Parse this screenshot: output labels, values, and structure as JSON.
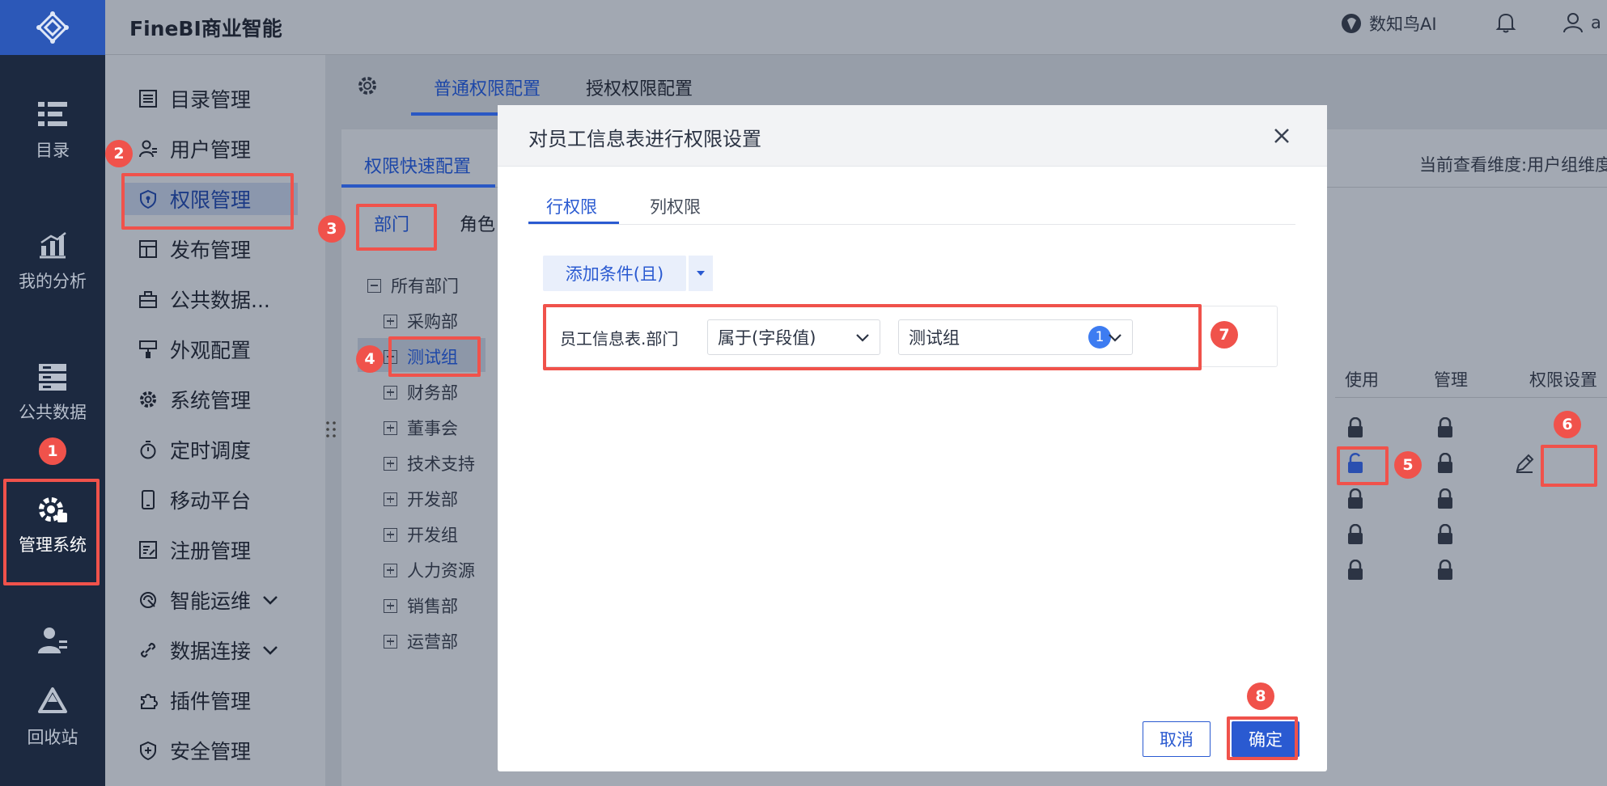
{
  "topbar": {
    "brand": "FineBI商业智能",
    "ai_label": "数知鸟AI",
    "user_initial": "a"
  },
  "leftnav": {
    "items": [
      {
        "label": "目录",
        "icon": "catalog-icon"
      },
      {
        "label": "我的分析",
        "icon": "analysis-icon"
      },
      {
        "label": "公共数据",
        "icon": "public-data-icon"
      },
      {
        "label": "管理系统",
        "icon": "admin-system-icon"
      },
      {
        "label": "",
        "icon": "user-admin-icon"
      },
      {
        "label": "回收站",
        "icon": "recycle-bin-icon"
      }
    ]
  },
  "subnav": {
    "items": [
      {
        "label": "目录管理",
        "icon": "list-icon"
      },
      {
        "label": "用户管理",
        "icon": "user-icon"
      },
      {
        "label": "权限管理",
        "icon": "shield-icon"
      },
      {
        "label": "发布管理",
        "icon": "publish-icon"
      },
      {
        "label": "公共数据...",
        "icon": "database-icon"
      },
      {
        "label": "外观配置",
        "icon": "brush-icon"
      },
      {
        "label": "系统管理",
        "icon": "gear-icon"
      },
      {
        "label": "定时调度",
        "icon": "timer-icon"
      },
      {
        "label": "移动平台",
        "icon": "mobile-icon"
      },
      {
        "label": "注册管理",
        "icon": "register-icon"
      },
      {
        "label": "智能运维",
        "icon": "ops-icon"
      },
      {
        "label": "数据连接",
        "icon": "link-icon"
      },
      {
        "label": "插件管理",
        "icon": "plugin-icon"
      },
      {
        "label": "安全管理",
        "icon": "security-icon"
      }
    ]
  },
  "content": {
    "top_tabs": [
      "普通权限配置",
      "授权权限配置"
    ],
    "panel_tab": "权限快速配置",
    "dimension_label": "当前查看维度:用户组维度",
    "sub_tabs": [
      "部门",
      "角色"
    ],
    "tree": {
      "root": "所有部门",
      "children": [
        "采购部",
        "测试组",
        "财务部",
        "董事会",
        "技术支持",
        "开发部",
        "开发组",
        "人力资源",
        "销售部",
        "运营部"
      ]
    },
    "table_headers": [
      "使用",
      "管理",
      "权限设置"
    ]
  },
  "modal": {
    "title": "对员工信息表进行权限设置",
    "tabs": [
      "行权限",
      "列权限"
    ],
    "add_button": "添加条件(且)",
    "condition": {
      "field": "员工信息表.部门",
      "operator": "属于(字段值)",
      "value": "测试组",
      "value_count": "1"
    },
    "cancel": "取消",
    "ok": "确定"
  },
  "callouts": [
    "1",
    "2",
    "3",
    "4",
    "5",
    "6",
    "7",
    "8"
  ],
  "colors": {
    "accent": "#2a5ad1",
    "callout": "#f0524b",
    "nav_bg": "#1c2940"
  }
}
